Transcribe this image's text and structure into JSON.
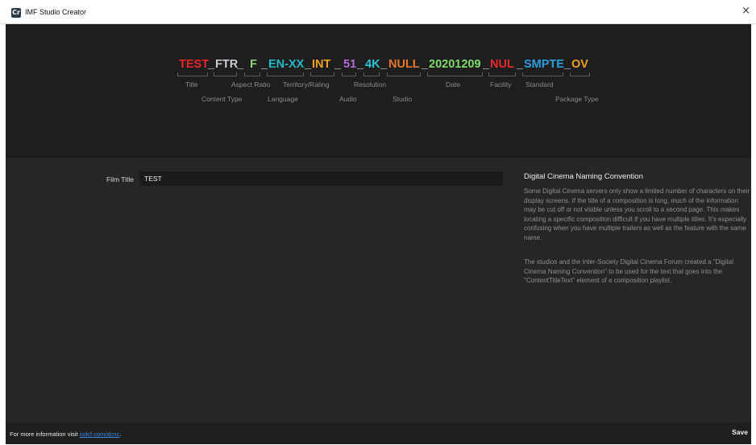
{
  "window": {
    "title": "IMF Studio Creator",
    "app_icon": "Cr",
    "close_glyph": "×"
  },
  "naming": {
    "segments": [
      {
        "text": "TEST",
        "color": "#e8262b"
      },
      {
        "text": "FTR",
        "color": "#c9ccd1"
      },
      {
        "text": "F",
        "color": "#8ed27a"
      },
      {
        "text": "EN-XX",
        "color": "#26b8c8"
      },
      {
        "text": "INT",
        "color": "#f0a020"
      },
      {
        "text": "51",
        "color": "#b26bd8"
      },
      {
        "text": "4K",
        "color": "#2ec3d6"
      },
      {
        "text": "NULL",
        "color": "#e27a2a"
      },
      {
        "text": "20201209",
        "color": "#7fdc6c"
      },
      {
        "text": "NUL",
        "color": "#e8262b"
      },
      {
        "text": "SMPTE",
        "color": "#2d9ee0"
      },
      {
        "text": "OV",
        "color": "#f0a020"
      }
    ],
    "separator": "_",
    "labels": {
      "title": "Title",
      "aspect_ratio": "Aspect Ratio",
      "territory_rating": "Territory/Rating",
      "resolution": "Resolution",
      "date": "Date",
      "facility": "Facility",
      "standard": "Standard",
      "content_type": "Content Type",
      "language": "Language",
      "audio": "Audio",
      "studio": "Studio",
      "package_type": "Package Type"
    }
  },
  "form": {
    "film_title_label": "Film Title",
    "film_title_value": "TEST"
  },
  "help": {
    "title": "Digital Cinema Naming Convention",
    "para1": "Some Digital Cinema servers only show a limited number of characters on their display screens. If the title of a composition is long, much of the information may be cut off or not visible unless you scroll to a second page. This makes locating a specific composition difficult if you have multiple titles. It's especially confusing when you have multiple trailers as well as the feature with the same name.",
    "para2": "The studios and the Inter-Society Digital Cinema Forum created a \"Digital Cinema Naming Convention\" to be used for the text that goes into the \"ContentTitleText\" element of a composition playlist."
  },
  "footer": {
    "info_text": "For more information visit ",
    "link_text": "isdcf.com/dcnc",
    "trailing": ".",
    "save_label": "Save"
  }
}
